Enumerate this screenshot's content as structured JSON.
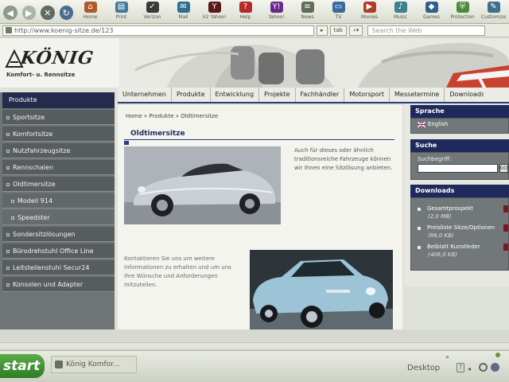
{
  "browser": {
    "toolbar_buttons": [
      {
        "label": "Home",
        "icon": "home-icon",
        "color": "#b05a2a",
        "glyph": "⌂"
      },
      {
        "label": "Print",
        "icon": "print-icon",
        "color": "#3e7a9a",
        "glyph": "▤"
      },
      {
        "label": "Verizon",
        "icon": "verizon-icon",
        "color": "#3a3a3a",
        "glyph": "✓"
      },
      {
        "label": "Mail",
        "icon": "mail-icon",
        "color": "#2f6d8e",
        "glyph": "✉"
      },
      {
        "label": "V2 Yahoo!",
        "icon": "yahoo-v2-icon",
        "color": "#5a1a1a",
        "glyph": "Y"
      },
      {
        "label": "Help",
        "icon": "help-icon",
        "color": "#b22a2a",
        "glyph": "?"
      },
      {
        "label": "Yahoo!",
        "icon": "yahoo-icon",
        "color": "#6b2a8a",
        "glyph": "Y!"
      },
      {
        "label": "News",
        "icon": "news-icon",
        "color": "#5f6d5b",
        "glyph": "≡"
      },
      {
        "label": "TV",
        "icon": "tv-icon",
        "color": "#3b6aa0",
        "glyph": "▭"
      },
      {
        "label": "Movies",
        "icon": "movies-icon",
        "color": "#b23b2a",
        "glyph": "▶"
      },
      {
        "label": "Music",
        "icon": "music-icon",
        "color": "#3f7f8f",
        "glyph": "♪"
      },
      {
        "label": "Games",
        "icon": "games-icon",
        "color": "#2f5f8f",
        "glyph": "◆"
      },
      {
        "label": "Protection",
        "icon": "protection-icon",
        "color": "#4b8a3b",
        "glyph": "⛨"
      },
      {
        "label": "Customize",
        "icon": "customize-icon",
        "color": "#3f6f8f",
        "glyph": "✎"
      }
    ],
    "url": "http://www.koenig-sitze.de/123",
    "go_label": "▸",
    "tab_label": "tab",
    "search_engine_label": "⌕▾",
    "search_placeholder": "Search the Web"
  },
  "site": {
    "logo_text": "KÖNIG",
    "logo_sub": "Komfort- u. Rennsitze",
    "topnav": [
      "Unternehmen",
      "Produkte",
      "Entwicklung",
      "Projekte",
      "Fachhändler",
      "Motorsport",
      "Messetermine",
      "Downloads"
    ],
    "leftnav_head": "Produkte",
    "leftnav": [
      {
        "label": "Sportsitze",
        "level": 0
      },
      {
        "label": "Komfortsitze",
        "level": 0
      },
      {
        "label": "Nutzfahrzeugsitze",
        "level": 0
      },
      {
        "label": "Rennschalen",
        "level": 0
      },
      {
        "label": "Oldtimersitze",
        "level": 0
      },
      {
        "label": "Modell 914",
        "level": 1
      },
      {
        "label": "Speedster",
        "level": 1
      },
      {
        "label": "Sondersitzlösungen",
        "level": 0
      },
      {
        "label": "Bürodrehstuhl Office Line",
        "level": 0
      },
      {
        "label": "Leitstellenstuhl Secur24",
        "level": 0
      },
      {
        "label": "Konsolen und Adapter",
        "level": 0
      }
    ],
    "breadcrumb": "Home » Produkte » Oldtimersitze",
    "page_title": "Oldtimersitze",
    "text1": "Auch für dieses oder ähnlich traditionsreiche Fahrzeuge können wir Ihnen eine Sitzlösung anbieten.",
    "text2": "Kontaktieren Sie uns um weitere Informationen zu erhalten und um uns Ihre Wünsche und Anforderungen mitzuteilen.",
    "sprache_head": "Sprache",
    "language": "English",
    "suche_head": "Suche",
    "search_label": "Suchbegriff:",
    "search_go": "GO",
    "downloads_head": "Downloads",
    "downloads": [
      {
        "title": "Gesamtprospekt",
        "size": "(2,0 MB)"
      },
      {
        "title": "Preisliste Sitze/Optionen",
        "size": "(66,0 KB)"
      },
      {
        "title": "Beiblatt Kunstleder",
        "size": "(406,0 KB)"
      }
    ]
  },
  "taskbar": {
    "start_label": "start",
    "task_label": "König Komfor...",
    "desktop_label": "Desktop",
    "tray_chevron": "»",
    "help_glyph": "?"
  }
}
